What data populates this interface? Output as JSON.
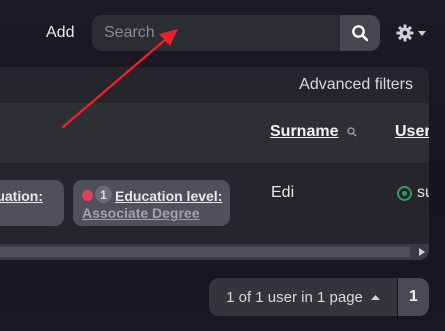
{
  "header": {
    "add_label": "Add",
    "search_placeholder": "Search",
    "search_icon": "search-icon",
    "settings_icon": "gear-icon"
  },
  "table": {
    "advanced_filters_label": "Advanced filters",
    "columns": [
      {
        "label": "Surname",
        "sort_icon": "search-icon"
      },
      {
        "label": "User"
      }
    ],
    "rows": [
      {
        "chips": [
          {
            "label": "situation:"
          },
          {
            "label": "Education level:",
            "count": "1",
            "value": "Associate Degree",
            "indicator_color": "#e0415b"
          }
        ],
        "surname": "Edi",
        "status": "su",
        "status_color": "#2f9e5f"
      }
    ]
  },
  "pagination": {
    "summary": "1 of 1 user in 1 page",
    "current_page": "1"
  },
  "annotation": {
    "type": "arrow",
    "color": "#e8212b"
  }
}
